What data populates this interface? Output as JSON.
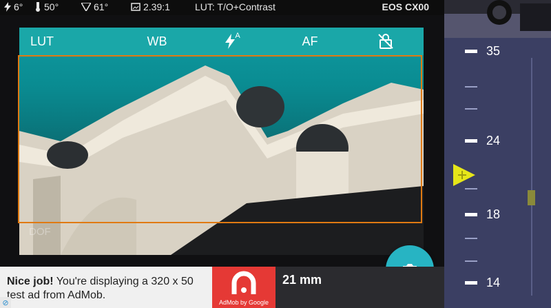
{
  "status": {
    "battery": "6°",
    "temp1": "50°",
    "temp2": "61°",
    "ratio": "2.39:1",
    "lut": "LUT: T/O+Contrast",
    "camera": "EOS CX00"
  },
  "toolbar": {
    "lut": "LUT",
    "wb": "WB",
    "flash_auto": "A",
    "af": "AF"
  },
  "viewfinder": {
    "dof_label": "DOF"
  },
  "ad": {
    "bold": "Nice job!",
    "text": " You're displaying a 320 x 50 test ad from AdMob.",
    "logo_caption": "AdMob by Google"
  },
  "lens": {
    "focal_length": "21 mm",
    "scale_labels": [
      "35",
      "24",
      "18",
      "14"
    ],
    "current_position_fraction": 0.5
  },
  "colors": {
    "toolbar": "#1aa7a8",
    "frame": "#e07a12",
    "shutter": "#27b4c3",
    "panel": "#3b3f63",
    "pointer": "#e6e619"
  }
}
